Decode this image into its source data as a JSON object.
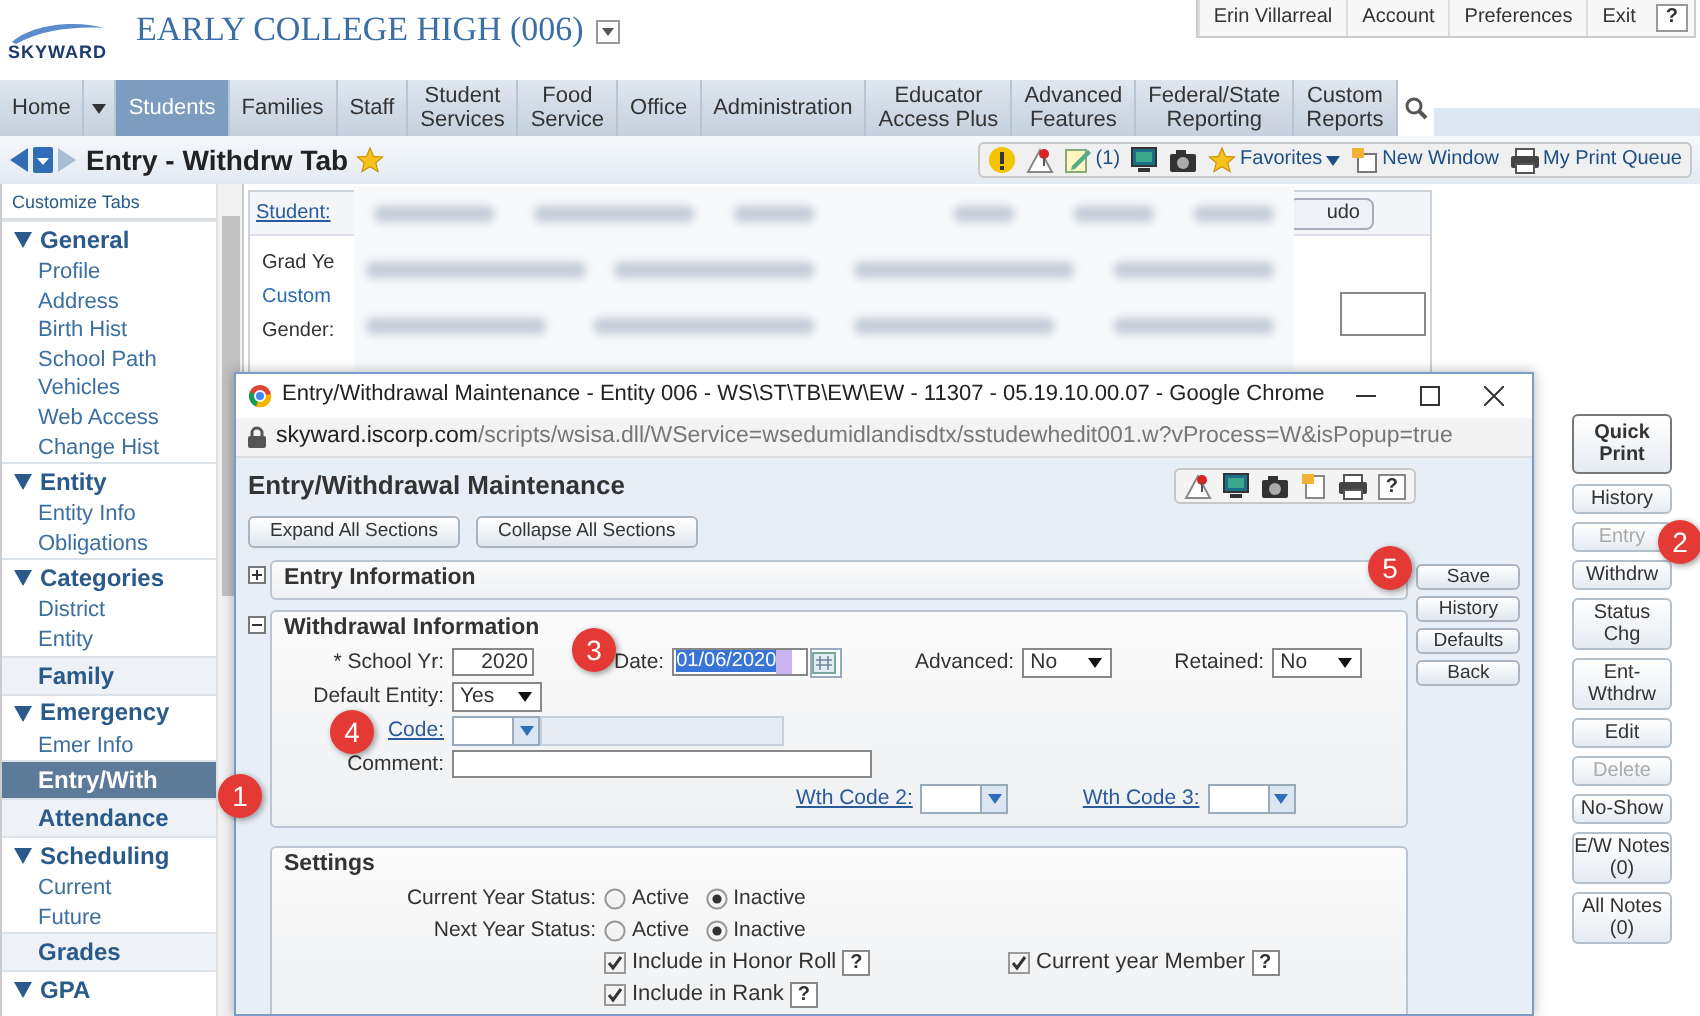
{
  "header": {
    "logo": "SKYWARD",
    "school": "EARLY COLLEGE HIGH (006)"
  },
  "user_menu": [
    {
      "label": "Erin Villarreal",
      "kind": "text"
    },
    {
      "label": "Account",
      "kind": "link"
    },
    {
      "label": "Preferences",
      "kind": "link"
    },
    {
      "label": "Exit",
      "kind": "link"
    },
    {
      "label": "?",
      "kind": "help"
    }
  ],
  "nav_tabs": [
    {
      "lines": [
        "Home"
      ],
      "selected": false,
      "menu": true
    },
    {
      "lines": [
        "Students"
      ],
      "selected": true
    },
    {
      "lines": [
        "Families"
      ],
      "selected": false
    },
    {
      "lines": [
        "Staff"
      ],
      "selected": false
    },
    {
      "lines": [
        "Student",
        "Services"
      ],
      "selected": false
    },
    {
      "lines": [
        "Food",
        "Service"
      ],
      "selected": false
    },
    {
      "lines": [
        "Office"
      ],
      "selected": false
    },
    {
      "lines": [
        "Administration"
      ],
      "selected": false
    },
    {
      "lines": [
        "Educator",
        "Access Plus"
      ],
      "selected": false
    },
    {
      "lines": [
        "Advanced",
        "Features"
      ],
      "selected": false
    },
    {
      "lines": [
        "Federal/State",
        "Reporting"
      ],
      "selected": false
    },
    {
      "lines": [
        "Custom",
        "Reports"
      ],
      "selected": false
    }
  ],
  "page": {
    "title": "Entry - Withdrw Tab"
  },
  "toolbar": [
    {
      "kind": "alert"
    },
    {
      "kind": "warning"
    },
    {
      "kind": "notes",
      "label": "(1)"
    },
    {
      "kind": "monitor"
    },
    {
      "kind": "camera"
    },
    {
      "kind": "favorites",
      "label": "Favorites",
      "menu": true
    },
    {
      "kind": "new-window",
      "label": "New Window"
    },
    {
      "kind": "print-queue",
      "label": "My Print Queue"
    }
  ],
  "sidebar": {
    "header": "Customize Tabs",
    "items": [
      {
        "kind": "group",
        "label": "General",
        "expanded": true,
        "children": [
          {
            "label": "Profile",
            "selected": false
          },
          {
            "label": "Address",
            "selected": false
          },
          {
            "label": "Birth Hist",
            "selected": false
          },
          {
            "label": "School Path",
            "selected": false
          },
          {
            "label": "Vehicles",
            "selected": false
          },
          {
            "label": "Web Access",
            "selected": false
          },
          {
            "label": "Change Hist",
            "selected": false
          }
        ]
      },
      {
        "kind": "group",
        "label": "Entity",
        "expanded": true,
        "children": [
          {
            "label": "Entity Info",
            "selected": false
          },
          {
            "label": "Obligations",
            "selected": false
          }
        ]
      },
      {
        "kind": "group",
        "label": "Categories",
        "expanded": true,
        "children": [
          {
            "label": "District",
            "selected": false
          },
          {
            "label": "Entity",
            "selected": false
          }
        ]
      },
      {
        "kind": "tab",
        "label": "Family",
        "selected": false
      },
      {
        "kind": "group",
        "label": "Emergency",
        "expanded": true,
        "children": [
          {
            "label": "Emer Info",
            "selected": false
          }
        ]
      },
      {
        "kind": "tab",
        "label": "Entry/With",
        "selected": true
      },
      {
        "kind": "tab",
        "label": "Attendance",
        "selected": false
      },
      {
        "kind": "group",
        "label": "Scheduling",
        "expanded": true,
        "children": [
          {
            "label": "Current",
            "selected": false
          },
          {
            "label": "Future",
            "selected": false
          }
        ]
      },
      {
        "kind": "tab",
        "label": "Grades",
        "selected": false
      },
      {
        "kind": "group",
        "label": "GPA",
        "expanded": true
      }
    ]
  },
  "student_panel": {
    "link": "Student:",
    "button": "udo",
    "labels": [
      {
        "text": "Grad Ye",
        "kind": "label"
      },
      {
        "text": "Custom",
        "kind": "link"
      },
      {
        "text": "Gender:",
        "kind": "label"
      }
    ]
  },
  "side_buttons": [
    {
      "lines": [
        "Quick",
        "Print"
      ],
      "kind": "primary",
      "disabled": false
    },
    {
      "lines": [
        "History"
      ],
      "kind": "normal",
      "disabled": false
    },
    {
      "lines": [
        "Entry"
      ],
      "kind": "normal",
      "disabled": true
    },
    {
      "lines": [
        "Withdrw"
      ],
      "kind": "normal",
      "disabled": false
    },
    {
      "lines": [
        "Status Chg"
      ],
      "kind": "normal",
      "disabled": false
    },
    {
      "lines": [
        "Ent-Wthdrw"
      ],
      "kind": "normal",
      "disabled": false
    },
    {
      "lines": [
        "Edit"
      ],
      "kind": "normal",
      "disabled": false
    },
    {
      "lines": [
        "Delete"
      ],
      "kind": "normal",
      "disabled": true
    },
    {
      "lines": [
        "No-Show"
      ],
      "kind": "normal",
      "disabled": false
    },
    {
      "lines": [
        "E/W Notes",
        "(0)"
      ],
      "kind": "normal",
      "disabled": false
    },
    {
      "lines": [
        "All Notes (0)"
      ],
      "kind": "normal",
      "disabled": false
    }
  ],
  "popup": {
    "window_title": "Entry/Withdrawal Maintenance - Entity 006 - WS\\ST\\TB\\EW\\EW - 11307 - 05.19.10.00.07 - Google Chrome",
    "url": {
      "host": "skyward.iscorp.com",
      "path": "/scripts/wsisa.dll/WService=wsedumidlandisdtx/sstudewhedit001.w?vProcess=W&isPopup=true"
    },
    "heading": "Entry/Withdrawal Maintenance",
    "tools": [
      {
        "kind": "warning"
      },
      {
        "kind": "monitor"
      },
      {
        "kind": "camera"
      },
      {
        "kind": "note"
      },
      {
        "kind": "printer"
      },
      {
        "kind": "help",
        "label": "?"
      }
    ],
    "section_buttons": [
      "Expand All Sections",
      "Collapse All Sections"
    ],
    "entry_section": {
      "title": "Entry Information",
      "expanded": false
    },
    "withdrawal_section": {
      "title": "Withdrawal Information",
      "expanded": true,
      "school_yr": {
        "label": "* School Yr:",
        "value": "2020"
      },
      "date": {
        "label": "Date:",
        "value": "01/06/2020"
      },
      "advanced": {
        "label": "Advanced:",
        "value": "No"
      },
      "retained": {
        "label": "Retained:",
        "value": "No"
      },
      "default_entity": {
        "label": "Default Entity:",
        "value": "Yes"
      },
      "code": {
        "label": "Code:"
      },
      "comment": {
        "label": "Comment:"
      },
      "wth_code_2": {
        "label": "Wth Code 2:"
      },
      "wth_code_3": {
        "label": "Wth Code 3:"
      }
    },
    "settings_section": {
      "title": "Settings",
      "radios": [
        {
          "label": "Current Year Status:",
          "options": [
            {
              "label": "Active",
              "selected": false
            },
            {
              "label": "Inactive",
              "selected": true
            }
          ]
        },
        {
          "label": "Next Year Status:",
          "options": [
            {
              "label": "Active",
              "selected": false
            },
            {
              "label": "Inactive",
              "selected": true
            }
          ]
        }
      ],
      "checks": [
        {
          "label": "Include in Honor Roll",
          "checked": true,
          "help": "?"
        },
        {
          "label": "Current year Member",
          "checked": true,
          "help": "?"
        },
        {
          "label": "Include in Rank",
          "checked": true,
          "help": "?"
        }
      ]
    },
    "actions": [
      "Save",
      "History",
      "Defaults",
      "Back"
    ]
  },
  "callouts": [
    "1",
    "2",
    "3",
    "4",
    "5"
  ]
}
